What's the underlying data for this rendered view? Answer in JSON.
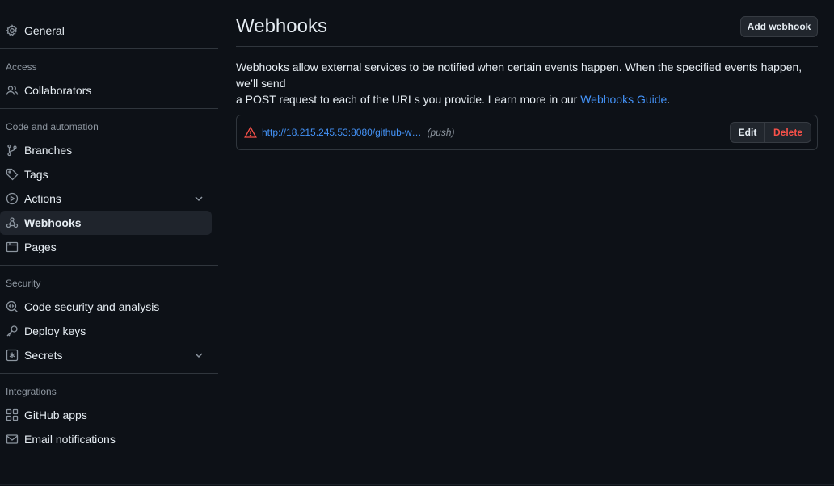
{
  "sidebar": {
    "general": "General",
    "sections": {
      "access": "Access",
      "code": "Code and automation",
      "security": "Security",
      "integrations": "Integrations"
    },
    "items": {
      "collaborators": "Collaborators",
      "branches": "Branches",
      "tags": "Tags",
      "actions": "Actions",
      "webhooks": "Webhooks",
      "pages": "Pages",
      "code_security": "Code security and analysis",
      "deploy_keys": "Deploy keys",
      "secrets": "Secrets",
      "github_apps": "GitHub apps",
      "email_notifications": "Email notifications"
    },
    "active": "webhooks"
  },
  "main": {
    "title": "Webhooks",
    "add_button": "Add webhook",
    "description_line1": "Webhooks allow external services to be notified when certain events happen. When the specified events happen, we’ll send",
    "description_line2": "a POST request to each of the URLs you provide. Learn more in our ",
    "guide_link": "Webhooks Guide",
    "description_end": ".",
    "webhook": {
      "url": "http://18.215.245.53:8080/github-w…",
      "events": "(push)",
      "status": "warning",
      "edit_label": "Edit",
      "delete_label": "Delete"
    }
  },
  "colors": {
    "background": "#0d1117",
    "link": "#4493f8",
    "danger": "#f85149",
    "muted": "#8d96a0",
    "border": "#30363d"
  }
}
